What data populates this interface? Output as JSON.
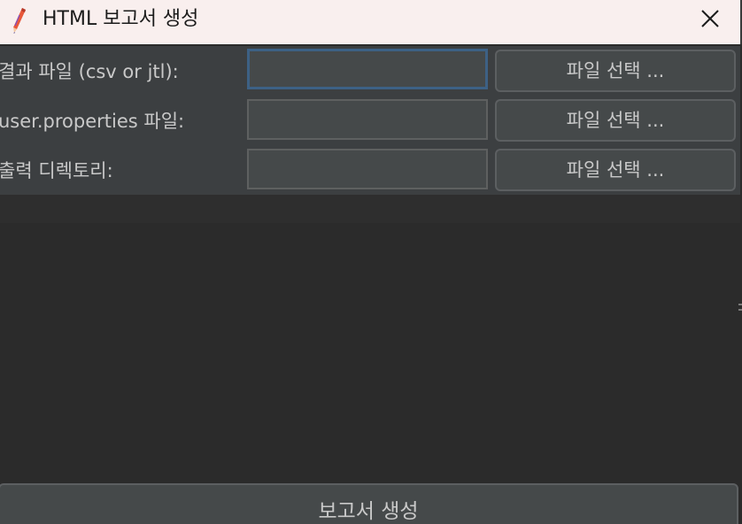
{
  "window": {
    "title": "HTML 보고서 생성",
    "icon": "pencil-icon",
    "close_icon": "close-icon"
  },
  "form": {
    "rows": [
      {
        "label": "결과 파일 (csv or jtl):",
        "value": "",
        "button_label": "파일 선택 ..."
      },
      {
        "label": "user.properties 파일:",
        "value": "",
        "button_label": "파일 선택 ..."
      },
      {
        "label": "출력 디렉토리:",
        "value": "",
        "button_label": "파일 선택 ..."
      }
    ]
  },
  "footer": {
    "generate_label": "보고서 생성"
  },
  "colors": {
    "titlebar_bg": "#f9efee",
    "panel_bg": "#3c3f41",
    "window_bg": "#2b2b2b",
    "focus_border": "#3d6185",
    "text": "#c9c9c9"
  }
}
